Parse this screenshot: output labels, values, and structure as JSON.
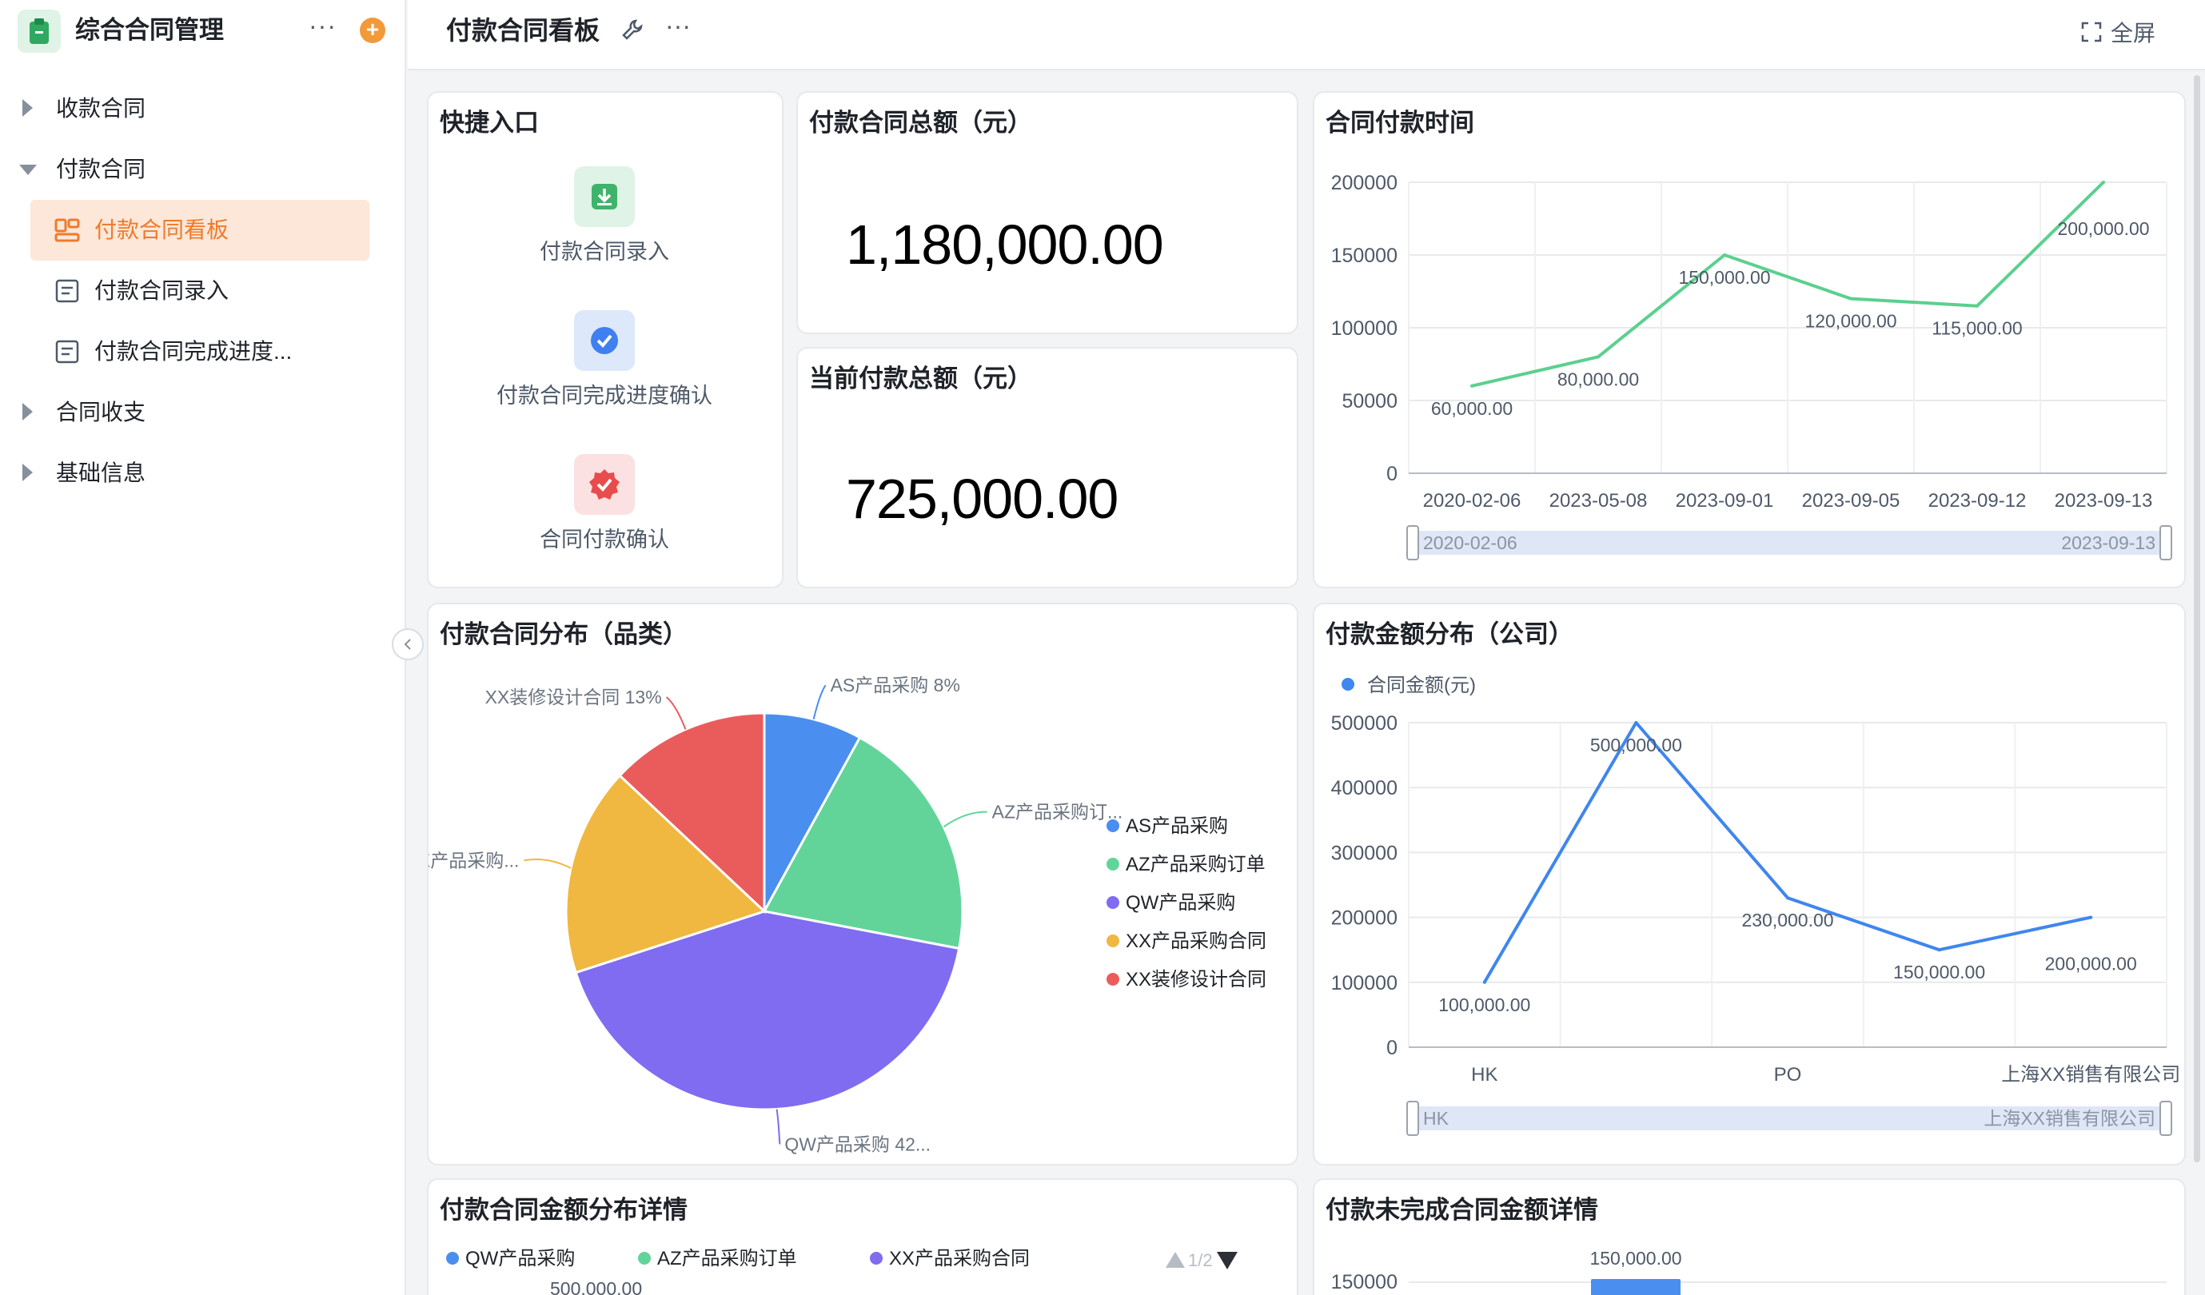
{
  "sidebar": {
    "app_title": "综合合同管理",
    "items": [
      {
        "label": "收款合同"
      },
      {
        "label": "付款合同"
      },
      {
        "label": "付款合同看板"
      },
      {
        "label": "付款合同录入"
      },
      {
        "label": "付款合同完成进度..."
      },
      {
        "label": "合同收支"
      },
      {
        "label": "基础信息"
      }
    ]
  },
  "topbar": {
    "title": "付款合同看板",
    "fullscreen_label": "全屏"
  },
  "quick_entry": {
    "title": "快捷入口",
    "items": [
      {
        "label": "付款合同录入",
        "icon": "download-icon",
        "color": "#3fb36b"
      },
      {
        "label": "付款合同完成进度确认",
        "icon": "check-circle-icon",
        "color": "#3f7ff0"
      },
      {
        "label": "合同付款确认",
        "icon": "badge-check-icon",
        "color": "#e84c4c"
      }
    ]
  },
  "kpis": {
    "total": {
      "title": "付款合同总额（元）",
      "value": "1,180,000.00"
    },
    "current": {
      "title": "当前付款总额（元）",
      "value": "725,000.00"
    }
  },
  "colors": {
    "accent": "#ee7b2c",
    "green_line": "#5bd08e",
    "blue_line": "#3f86ee"
  },
  "charts": {
    "time": {
      "title": "合同付款时间"
    },
    "category": {
      "title": "付款合同分布（品类）"
    },
    "company": {
      "title": "付款金额分布（公司）"
    },
    "detail": {
      "title": "付款合同金额分布详情",
      "pager": "1/2"
    },
    "unfinished": {
      "title": "付款未完成合同金额详情"
    }
  },
  "chart_data": [
    {
      "type": "line",
      "title": "合同付款时间",
      "x": [
        "2020-02-06",
        "2023-05-08",
        "2023-09-01",
        "2023-09-05",
        "2023-09-12",
        "2023-09-13"
      ],
      "values": [
        60000,
        80000,
        150000,
        120000,
        115000,
        200000
      ],
      "labels": [
        "60,000.00",
        "80,000.00",
        "150,000.00",
        "120,000.00",
        "115,000.00",
        "200,000.00"
      ],
      "ylim": [
        0,
        200000
      ],
      "yticks": [
        "0",
        "50000",
        "100000",
        "150000",
        "200000"
      ],
      "zoom_range": [
        "2020-02-06",
        "2023-09-13"
      ],
      "grid": true
    },
    {
      "type": "pie",
      "title": "付款合同分布（品类）",
      "slices": [
        {
          "name": "AS产品采购",
          "value": 8,
          "color": "#4a8ef0",
          "label": "AS产品采购 8%"
        },
        {
          "name": "AZ产品采购订单",
          "value": 20,
          "color": "#62d49a",
          "label": "AZ产品采购订..."
        },
        {
          "name": "QW产品采购",
          "value": 42,
          "color": "#7f6cf0",
          "label": "QW产品采购 42..."
        },
        {
          "name": "XX产品采购合同",
          "value": 17,
          "color": "#f0b840",
          "label": "XX产品采购..."
        },
        {
          "name": "XX装修设计合同",
          "value": 13,
          "color": "#ea5c5c",
          "label": "XX装修设计合同 13%"
        }
      ],
      "legend_position": "right"
    },
    {
      "type": "line",
      "title": "付款金额分布（公司）",
      "legend": "合同金额(元)",
      "x_tick_labels": [
        "HK",
        "PO",
        "上海XX销售有限公司"
      ],
      "values": [
        100000,
        500000,
        230000,
        150000,
        200000
      ],
      "labels": [
        "100,000.00",
        "500,000.00",
        "230,000.00",
        "150,000.00",
        "200,000.00"
      ],
      "ylim": [
        0,
        500000
      ],
      "yticks": [
        "0",
        "100000",
        "200000",
        "300000",
        "400000",
        "500000"
      ],
      "zoom_range": [
        "HK",
        "上海XX销售有限公司"
      ],
      "grid": true
    },
    {
      "type": "bar",
      "title": "付款合同金额分布详情",
      "series": [
        {
          "name": "QW产品采购",
          "color": "#4a8ef0"
        },
        {
          "name": "AZ产品采购订单",
          "color": "#62d49a"
        },
        {
          "name": "XX产品采购合同",
          "color": "#7f6cf0"
        }
      ],
      "visible_labels": [
        "500,000.00"
      ]
    },
    {
      "type": "bar",
      "title": "付款未完成合同金额详情",
      "values": [
        150000
      ],
      "labels": [
        "150,000.00"
      ],
      "yticks": [
        "150000"
      ]
    }
  ]
}
